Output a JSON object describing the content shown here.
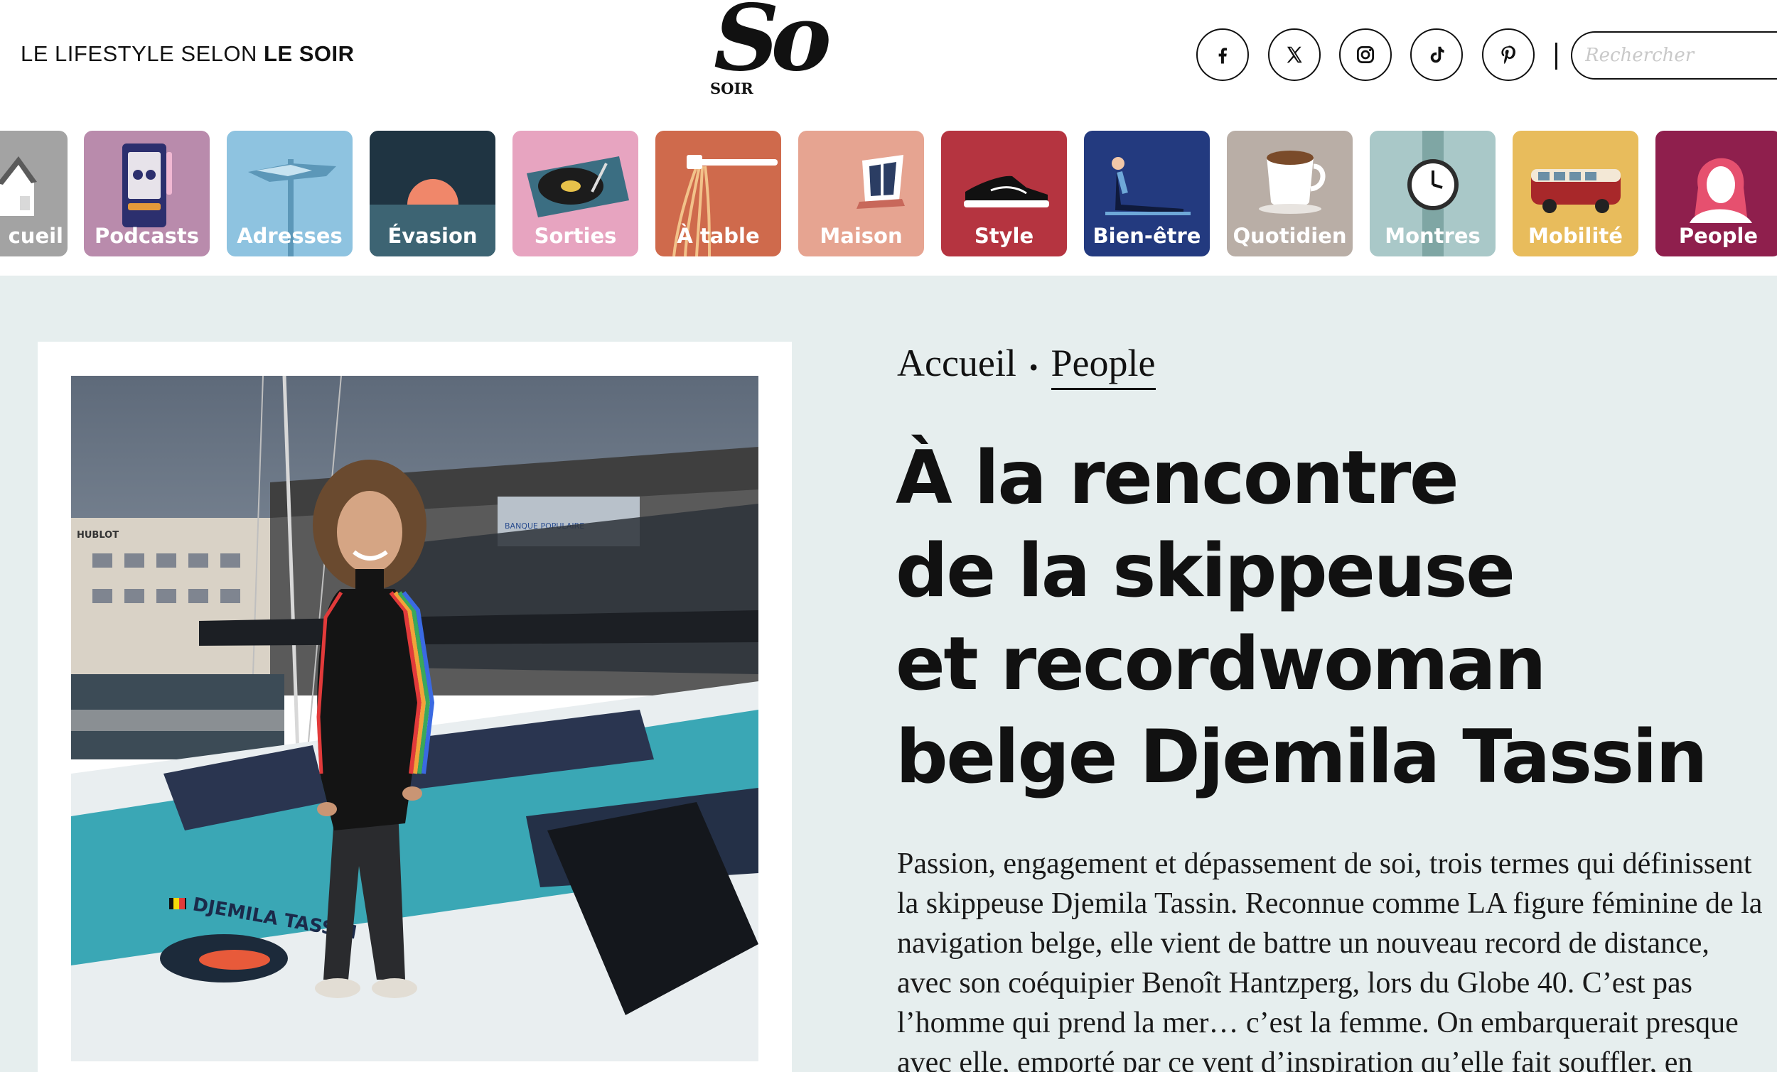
{
  "header": {
    "tagline_prefix": "LE LIFESTYLE SELON ",
    "tagline_brand": "LE SOIR",
    "logo_main": "So",
    "logo_sub": "SOIR",
    "social": [
      {
        "name": "facebook-icon"
      },
      {
        "name": "x-icon"
      },
      {
        "name": "instagram-icon"
      },
      {
        "name": "tiktok-icon"
      },
      {
        "name": "pinterest-icon"
      }
    ],
    "search_placeholder": "Rechercher"
  },
  "nav": {
    "categories": [
      {
        "label": "cueil",
        "color": "#a3a3a3",
        "icon": "house-icon"
      },
      {
        "label": "Podcasts",
        "color": "#b98bac",
        "icon": "cassette-player-icon"
      },
      {
        "label": "Adresses",
        "color": "#8ec3e0",
        "icon": "signpost-icon"
      },
      {
        "label": "Évasion",
        "color": "#1f3442",
        "icon": "sunset-icon"
      },
      {
        "label": "Sorties",
        "color": "#e7a4c0",
        "icon": "turntable-icon"
      },
      {
        "label": "À table",
        "color": "#cf6a4c",
        "icon": "fork-spaghetti-icon"
      },
      {
        "label": "Maison",
        "color": "#e6a491",
        "icon": "window-icon"
      },
      {
        "label": "Style",
        "color": "#b53440",
        "icon": "sneaker-icon"
      },
      {
        "label": "Bien-être",
        "color": "#233a7f",
        "icon": "yoga-pose-icon"
      },
      {
        "label": "Quotidien",
        "color": "#b9aea6",
        "icon": "coffee-cup-icon"
      },
      {
        "label": "Montres",
        "color": "#a9c8c8",
        "icon": "watch-icon"
      },
      {
        "label": "Mobilité",
        "color": "#e8bc5c",
        "icon": "van-icon"
      },
      {
        "label": "People",
        "color": "#8f1f4d",
        "icon": "woman-portrait-icon"
      }
    ]
  },
  "article": {
    "breadcrumb": [
      "Accueil",
      "People"
    ],
    "title_lines": [
      "À la rencontre",
      "de la skippeuse",
      "et recordwoman",
      "belge Djemila Tassin"
    ],
    "lead_lines": [
      "Passion, engagement et dépassement de soi, trois termes qui définissent",
      "la skippeuse Djemila Tassin. Reconnue comme LA figure féminine de la",
      "navigation belge, elle vient de battre un nouveau record de distance,",
      "avec son coéquipier Benoît Hantzperg, lors du Globe 40. C’est pas",
      "l’homme qui prend la mer… c’est la femme. On embarquerait presque",
      "avec elle, emporté par ce vent d’inspiration qu’elle fait souffler, en"
    ],
    "photo": {
      "boat_name": "DJEMILA TASSIN",
      "sign_hublot": "HUBLOT",
      "sign_bank": "BANQUE POPULAIRE",
      "colors": {
        "sky": "#6f7d8e",
        "hull_teal": "#3aa7b5",
        "deck": "#e9eef0"
      }
    }
  }
}
